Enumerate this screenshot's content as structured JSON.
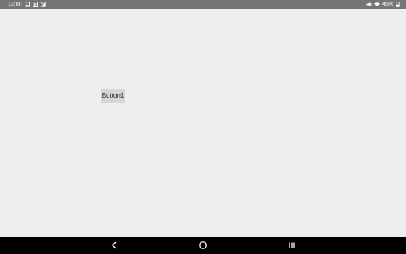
{
  "status_bar": {
    "time": "13:00",
    "left_icons": [
      "image-icon",
      "nfc-icon",
      "no-signal-icon"
    ],
    "right_icons": [
      "mute-icon",
      "wifi-icon"
    ],
    "battery": "49%",
    "battery_icon": "battery-icon"
  },
  "main": {
    "button1_label": "Button1"
  },
  "nav_bar": {
    "items": [
      "back-icon",
      "home-icon",
      "recents-icon"
    ]
  },
  "colors": {
    "status_bar_bg": "#757575",
    "content_bg": "#eeeeee",
    "button_bg": "#d6d6d6",
    "nav_bar_bg": "#000000"
  }
}
